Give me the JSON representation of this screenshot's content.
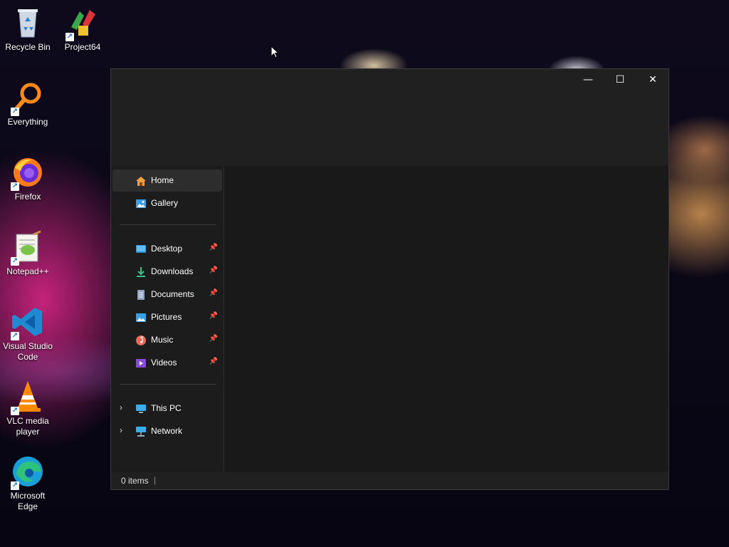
{
  "desktop": {
    "icons": [
      {
        "label": "Recycle Bin",
        "icon": "recycle-bin-icon",
        "shortcut": false
      },
      {
        "label": "Project64",
        "icon": "project64-icon",
        "shortcut": true
      },
      {
        "label": "Everything",
        "icon": "everything-icon",
        "shortcut": true
      },
      {
        "label": "Firefox",
        "icon": "firefox-icon",
        "shortcut": true
      },
      {
        "label": "Notepad++",
        "icon": "notepadpp-icon",
        "shortcut": true
      },
      {
        "label": "Visual Studio Code",
        "icon": "vscode-icon",
        "shortcut": true
      },
      {
        "label": "VLC media player",
        "icon": "vlc-icon",
        "shortcut": true
      },
      {
        "label": "Microsoft Edge",
        "icon": "edge-icon",
        "shortcut": true
      }
    ]
  },
  "explorer": {
    "caption": {
      "minimize": "—",
      "maximize": "☐",
      "close": "✕"
    },
    "nav": {
      "top": [
        {
          "label": "Home",
          "icon": "home-icon",
          "selected": true
        },
        {
          "label": "Gallery",
          "icon": "gallery-icon"
        }
      ],
      "pinned": [
        {
          "label": "Desktop",
          "icon": "desktop-folder-icon"
        },
        {
          "label": "Downloads",
          "icon": "downloads-icon"
        },
        {
          "label": "Documents",
          "icon": "documents-icon"
        },
        {
          "label": "Pictures",
          "icon": "pictures-icon"
        },
        {
          "label": "Music",
          "icon": "music-icon"
        },
        {
          "label": "Videos",
          "icon": "videos-icon"
        }
      ],
      "drives": [
        {
          "label": "This PC",
          "icon": "this-pc-icon"
        },
        {
          "label": "Network",
          "icon": "network-icon"
        }
      ],
      "pin_glyph": "📌",
      "chevron_glyph": "›"
    },
    "status": {
      "items_text": "0 items",
      "divider": "|"
    }
  },
  "colors": {
    "window_bg": "#202020",
    "nav_bg": "#1c1c1c",
    "selected_bg": "#2d2d2d",
    "accent": "#0078d4"
  }
}
